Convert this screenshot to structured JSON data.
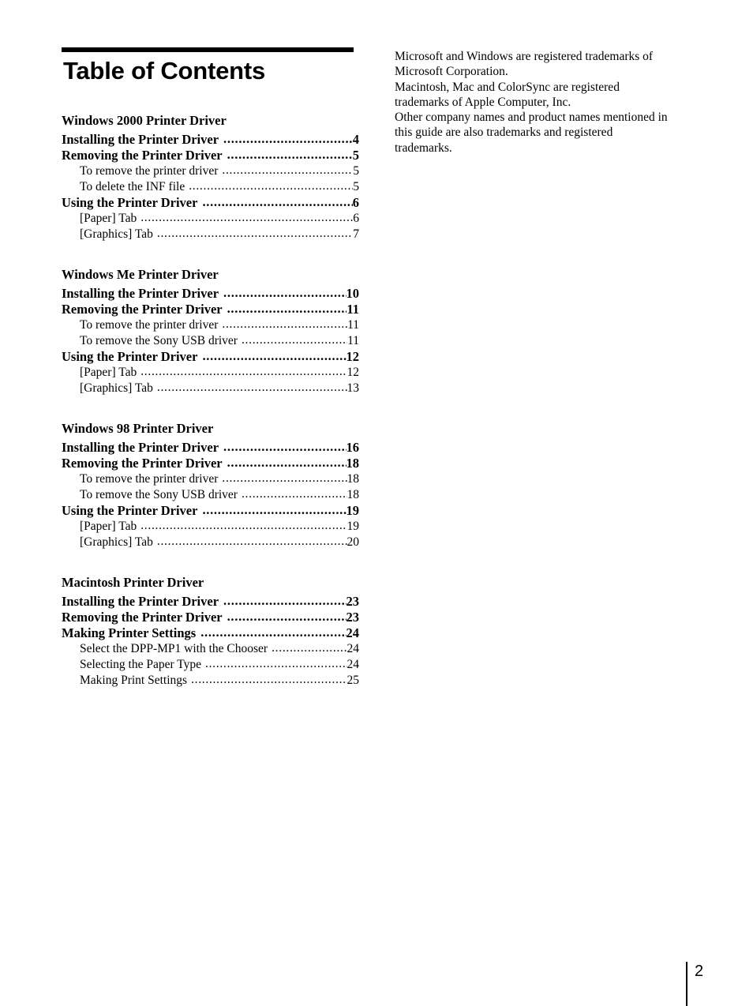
{
  "document": {
    "title": "Table of Contents",
    "page_number": "2"
  },
  "toc": {
    "sections": [
      {
        "heading": "Windows 2000 Printer Driver",
        "entries": [
          {
            "level": 1,
            "label": "Installing the Printer Driver",
            "page": "4"
          },
          {
            "level": 1,
            "label": "Removing the Printer Driver",
            "page": "5"
          },
          {
            "level": 2,
            "label": "To remove the printer driver",
            "page": "5"
          },
          {
            "level": 2,
            "label": "To delete the INF file",
            "page": "5"
          },
          {
            "level": 1,
            "label": "Using the Printer Driver",
            "page": "6"
          },
          {
            "level": 2,
            "label": "[Paper] Tab",
            "page": "6"
          },
          {
            "level": 2,
            "label": "[Graphics] Tab",
            "page": "7"
          }
        ]
      },
      {
        "heading": "Windows Me Printer Driver",
        "entries": [
          {
            "level": 1,
            "label": "Installing the Printer Driver",
            "page": "10"
          },
          {
            "level": 1,
            "label": "Removing the Printer Driver",
            "page": "11"
          },
          {
            "level": 2,
            "label": "To remove the printer driver",
            "page": "11"
          },
          {
            "level": 2,
            "label": "To remove the Sony USB driver",
            "page": "11"
          },
          {
            "level": 1,
            "label": "Using the Printer Driver",
            "page": "12"
          },
          {
            "level": 2,
            "label": "[Paper] Tab",
            "page": "12"
          },
          {
            "level": 2,
            "label": "[Graphics] Tab",
            "page": "13"
          }
        ]
      },
      {
        "heading": "Windows 98 Printer Driver",
        "entries": [
          {
            "level": 1,
            "label": "Installing the Printer Driver",
            "page": "16"
          },
          {
            "level": 1,
            "label": "Removing the Printer Driver",
            "page": "18"
          },
          {
            "level": 2,
            "label": "To remove the printer driver",
            "page": "18"
          },
          {
            "level": 2,
            "label": "To remove the Sony USB driver",
            "page": "18"
          },
          {
            "level": 1,
            "label": "Using the Printer Driver",
            "page": "19"
          },
          {
            "level": 2,
            "label": "[Paper] Tab",
            "page": "19"
          },
          {
            "level": 2,
            "label": "[Graphics] Tab",
            "page": "20"
          }
        ]
      },
      {
        "heading": "Macintosh Printer Driver",
        "entries": [
          {
            "level": 1,
            "label": "Installing the Printer Driver",
            "page": "23"
          },
          {
            "level": 1,
            "label": "Removing the Printer Driver",
            "page": "23"
          },
          {
            "level": 1,
            "label": "Making Printer Settings",
            "page": "24"
          },
          {
            "level": 2,
            "label": "Select the DPP-MP1 with the Chooser",
            "page": "24"
          },
          {
            "level": 2,
            "label": "Selecting the Paper Type",
            "page": "24"
          },
          {
            "level": 2,
            "label": "Making Print Settings",
            "page": "25"
          }
        ]
      }
    ]
  },
  "notice": {
    "lines": [
      "Microsoft and Windows are registered trademarks of",
      "Microsoft Corporation.",
      "Macintosh, Mac and ColorSync are registered",
      "trademarks of Apple Computer, Inc.",
      "Other company names and product names mentioned in",
      "this guide are also trademarks and registered",
      "trademarks."
    ]
  }
}
